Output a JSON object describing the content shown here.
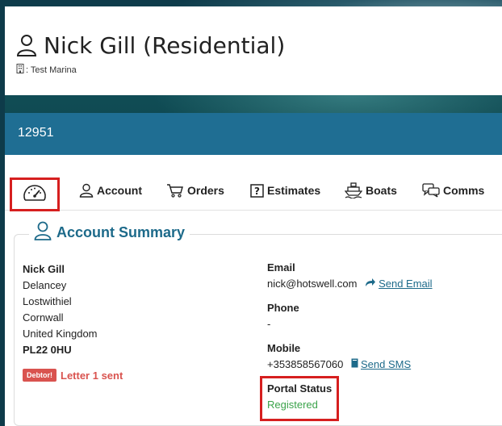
{
  "header": {
    "name": "Nick Gill (Residential)",
    "marina": ": Test Marina"
  },
  "band": {
    "id": "12951"
  },
  "tabs": [
    {
      "label": "",
      "icon": "dashboard-gauge-icon"
    },
    {
      "label": "Account",
      "icon": "user-icon"
    },
    {
      "label": "Orders",
      "icon": "cart-icon"
    },
    {
      "label": "Estimates",
      "icon": "question-square-icon"
    },
    {
      "label": "Boats",
      "icon": "ship-icon"
    },
    {
      "label": "Comms",
      "icon": "chat-icon"
    }
  ],
  "summary": {
    "title": "Account Summary",
    "address": {
      "name": "Nick Gill",
      "line1": "Delancey",
      "line2": "Lostwithiel",
      "line3": "Cornwall",
      "line4": "United Kingdom",
      "postcode": "PL22 0HU"
    },
    "debtor_badge": "Debtor!",
    "debtor_text": "Letter 1 sent",
    "email_label": "Email",
    "email_value": "nick@hotswell.com",
    "send_email": "Send Email",
    "phone_label": "Phone",
    "phone_value": "-",
    "mobile_label": "Mobile",
    "mobile_value": "+353858567060",
    "send_sms": "Send SMS",
    "portal_label": "Portal Status",
    "portal_value": "Registered"
  },
  "colors": {
    "accent": "#1f6e93",
    "title_blue": "#1d6a8a",
    "highlight_red": "#d61f1f",
    "debtor_red": "#d9534f",
    "registered_green": "#3aa34a"
  }
}
